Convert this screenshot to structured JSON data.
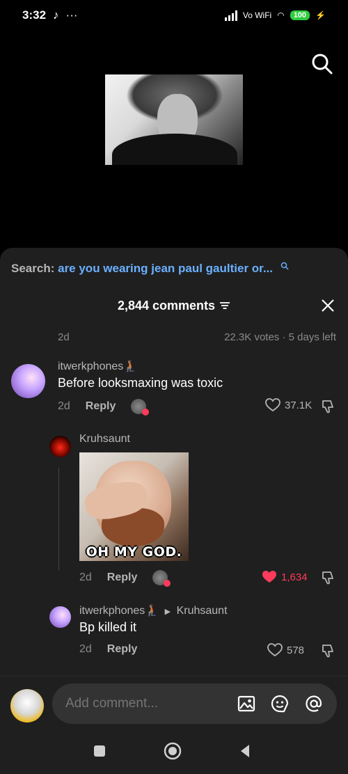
{
  "status_bar": {
    "time": "3:32",
    "extra": "···",
    "network": "Vo WiFi",
    "battery": "100"
  },
  "search": {
    "prefix": "Search:",
    "query": "are you wearing jean paul gaultier or..."
  },
  "comments_header": {
    "count_label": "2,844 comments"
  },
  "poll_row": {
    "age": "2d",
    "votes": "22.3K votes · 5 days left"
  },
  "comments": [
    {
      "author": "itwerkphones🧎🏽",
      "text": "Before looksmaxing was toxic",
      "age": "2d",
      "reply_label": "Reply",
      "likes": "37.1K",
      "liked": false
    },
    {
      "author": "Kruhsaunt",
      "gif_caption": "OH MY GOD.",
      "age": "2d",
      "reply_label": "Reply",
      "likes": "1,634",
      "liked": true
    },
    {
      "author": "itwerkphones🧎🏽",
      "reply_to": "Kruhsaunt",
      "text": "Bp killed it",
      "age": "2d",
      "reply_label": "Reply",
      "likes": "578",
      "liked": false
    }
  ],
  "composer": {
    "placeholder": "Add comment..."
  },
  "colors": {
    "accent_link": "#6ab0ff",
    "like_red": "#ff3b5c",
    "sheet_bg": "#1f1f1f"
  },
  "icons": [
    "search-icon",
    "filter-icon",
    "close-icon",
    "heart-icon",
    "dislike-icon",
    "image-icon",
    "emoji-icon",
    "mention-icon",
    "nav-home-icon",
    "nav-back-icon",
    "nav-recents-icon"
  ]
}
